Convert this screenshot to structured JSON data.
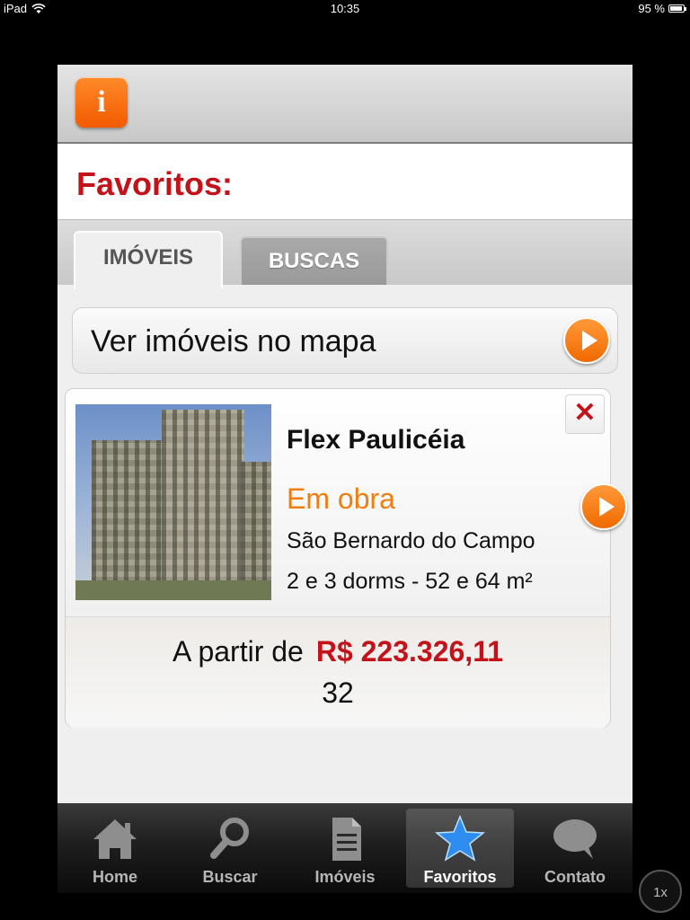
{
  "status_bar": {
    "device": "iPad",
    "time": "10:35",
    "battery": "95 %",
    "battery_level": 0.95
  },
  "header": {
    "info_button_label": "i",
    "title": "Favoritos:"
  },
  "tabs": [
    {
      "label": "IMÓVEIS",
      "active": true
    },
    {
      "label": "BUSCAS",
      "active": false
    }
  ],
  "map_link": {
    "label": "Ver imóveis no mapa"
  },
  "listing": {
    "name": "Flex Paulicéia",
    "status": "Em obra",
    "city": "São Bernardo do Campo",
    "dorms": "2 e 3 dorms - 52 e 64 m²",
    "price_prefix": "A partir de",
    "price": "R$ 223.326,11",
    "extra": "32",
    "remove_label": "X"
  },
  "bottom_tabs": [
    {
      "label": "Home",
      "icon": "home-icon",
      "active": false
    },
    {
      "label": "Buscar",
      "icon": "search-icon",
      "active": false
    },
    {
      "label": "Imóveis",
      "icon": "document-icon",
      "active": false
    },
    {
      "label": "Favoritos",
      "icon": "star-icon",
      "active": true
    },
    {
      "label": "Contato",
      "icon": "chat-bubble-icon",
      "active": false
    }
  ],
  "zoom_label": "1x",
  "colors": {
    "accent_red": "#c4121a",
    "accent_orange": "#f07d10",
    "active_tab_blue": "#2f8df0"
  }
}
